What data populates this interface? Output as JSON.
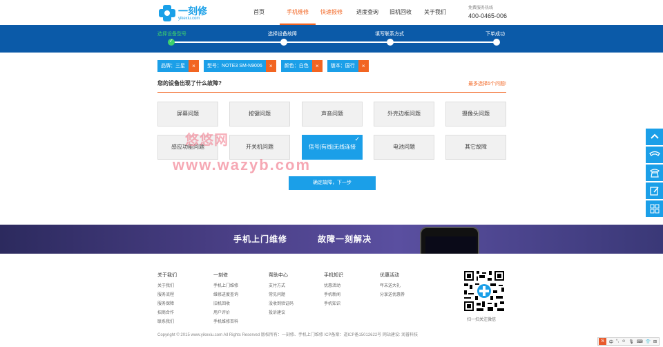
{
  "header": {
    "logo_cn": "一刻修",
    "logo_en": "yikexiu.com",
    "nav": [
      {
        "label": "首页",
        "active": false
      },
      {
        "label": "手机维修",
        "active": true
      },
      {
        "label": "快速报修",
        "active": false,
        "highlight": true
      },
      {
        "label": "进度查询",
        "active": false
      },
      {
        "label": "旧机回收",
        "active": false
      },
      {
        "label": "关于我们",
        "active": false
      }
    ],
    "hotline_label": "免费服务热线",
    "hotline_number": "400-0465-006"
  },
  "progress": {
    "steps": [
      {
        "label": "选择设备型号",
        "done": true
      },
      {
        "label": "选择设备故障",
        "done": false
      },
      {
        "label": "填写联系方式",
        "done": false
      },
      {
        "label": "下单成功",
        "done": false
      }
    ],
    "check_glyph": "✓"
  },
  "tags": [
    {
      "label": "品牌：三星"
    },
    {
      "label": "型号：NOTE3 SM-N9006"
    },
    {
      "label": "颜色：白色"
    },
    {
      "label": "版本：国行"
    }
  ],
  "tag_remove_glyph": "×",
  "question": {
    "title": "您的设备出现了什么故障?",
    "hint": "最多选择5个问题!"
  },
  "faults": [
    {
      "label": "屏幕问题",
      "selected": false
    },
    {
      "label": "按键问题",
      "selected": false
    },
    {
      "label": "声音问题",
      "selected": false
    },
    {
      "label": "外壳边框问题",
      "selected": false
    },
    {
      "label": "摄像头问题",
      "selected": false
    },
    {
      "label": "感应功能问题",
      "selected": false
    },
    {
      "label": "开关机问题",
      "selected": false
    },
    {
      "label": "信号|有线|无线连接",
      "selected": true
    },
    {
      "label": "电池问题",
      "selected": false
    },
    {
      "label": "其它故障",
      "selected": false
    }
  ],
  "confirm_label": "确定故障，下一步",
  "watermark": {
    "cn": "悠悠网",
    "en": "www.wazyb.com"
  },
  "banner": {
    "left": "手机上门维修",
    "right": "故障一刻解决"
  },
  "footer": {
    "columns": [
      {
        "title": "关于我们",
        "items": [
          "关于我们",
          "服务流程",
          "服务保障",
          "招商合作",
          "联系我们"
        ]
      },
      {
        "title": "一刻修",
        "items": [
          "手机上门维修",
          "维修进度查询",
          "旧机回收",
          "用户评价",
          "手机维修百科"
        ]
      },
      {
        "title": "帮助中心",
        "items": [
          "支付方式",
          "常见问题",
          "没收到验证码",
          "投诉建议"
        ]
      },
      {
        "title": "手机知识",
        "items": [
          "优惠活动",
          "手机新闻",
          "手机知识"
        ]
      },
      {
        "title": "优惠活动",
        "items": [
          "年末送大礼",
          "分享送优惠券"
        ]
      }
    ],
    "qr_caption": "扫一扫关注微信",
    "copyright": "Copyright © 2015 www.yikexiu.com All Rights Reserved   版权所有：一刻修、手机上门维修  ICP备案：道ICP备15012622号 网站建设: 润普科技"
  },
  "side_icons": [
    "up-arrow-icon",
    "phone-icon",
    "telephone-icon",
    "edit-icon",
    "grid-icon"
  ],
  "ime": {
    "logo": "S",
    "items": [
      "中",
      "°,",
      "☺",
      "🎙",
      "⌨",
      "👕",
      "⊞"
    ]
  }
}
